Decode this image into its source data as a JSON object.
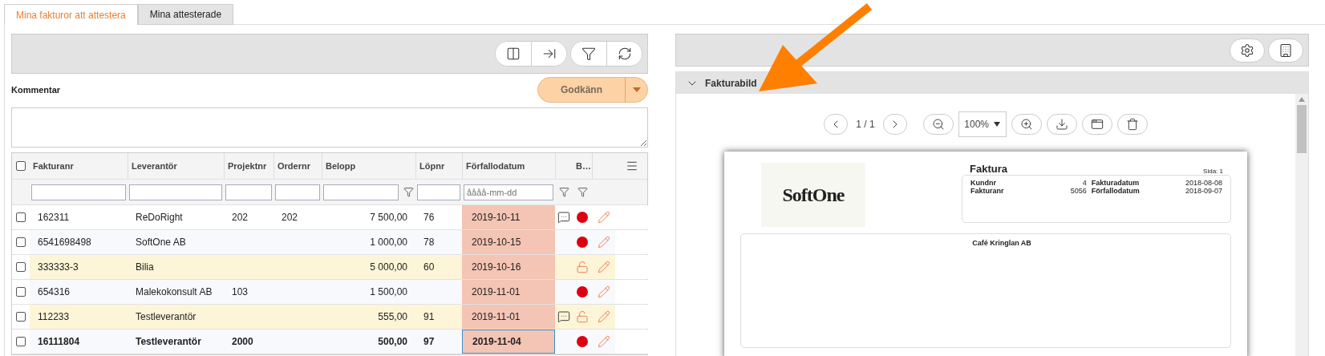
{
  "tabs": [
    {
      "label": "Mina fakturor att attestera",
      "selected": true
    },
    {
      "label": "Mina attesterade",
      "selected": false
    }
  ],
  "left_panel": {
    "comment_label": "Kommentar",
    "approve_button": "Godkänn",
    "table": {
      "select_all_checked": false,
      "columns": [
        "Fakturanr",
        "Leverantör",
        "Projektnr",
        "Ordernr",
        "Belopp",
        "Löpnr",
        "Förfallodatum",
        "B…"
      ],
      "date_filter_placeholder": "åååå-mm-dd",
      "rows": [
        {
          "checked": false,
          "fakturanr": "162311",
          "leverantor": "ReDoRight",
          "projektnr": "202",
          "ordernr": "202",
          "belopp": "7 500,00",
          "lopnr": "76",
          "forfallodatum": "2019-10-11",
          "comment": true,
          "locked": false,
          "highlighted": false,
          "selected": false
        },
        {
          "checked": false,
          "fakturanr": "6541698498",
          "leverantor": "SoftOne AB",
          "belopp": "1 000,00",
          "lopnr": "78",
          "forfallodatum": "2019-10-15",
          "comment": false,
          "locked": false,
          "highlighted": false,
          "selected": false
        },
        {
          "checked": false,
          "fakturanr": "333333-3",
          "leverantor": "Bilia",
          "belopp": "5 000,00",
          "lopnr": "60",
          "forfallodatum": "2019-10-16",
          "comment": false,
          "locked": true,
          "highlighted": true,
          "selected": false
        },
        {
          "checked": false,
          "fakturanr": "654316",
          "leverantor": "Malekokonsult AB",
          "projektnr": "103",
          "belopp": "1 500,00",
          "forfallodatum": "2019-11-01",
          "comment": false,
          "locked": false,
          "highlighted": false,
          "selected": false
        },
        {
          "checked": false,
          "fakturanr": "112233",
          "leverantor": "Testleverantör",
          "belopp": "555,00",
          "lopnr": "91",
          "forfallodatum": "2019-11-01",
          "comment": true,
          "locked": true,
          "highlighted": true,
          "selected": false
        },
        {
          "checked": false,
          "fakturanr": "16111804",
          "leverantor": "Testleverantör",
          "projektnr": "2000",
          "belopp": "500,00",
          "lopnr": "97",
          "forfallodatum": "2019-11-04",
          "comment": false,
          "locked": false,
          "highlighted": false,
          "selected": true
        }
      ]
    }
  },
  "invoice_viewer": {
    "title": "Fakturabild",
    "expanded": true,
    "page_indicator": "1 / 1",
    "zoom": "100%",
    "document": {
      "logo": "SoftOne",
      "title": "Faktura",
      "page_label": "Sida:",
      "page_number": "1",
      "fields": [
        {
          "label": "Kundnr",
          "value": "4"
        },
        {
          "label": "Fakturadatum",
          "value": "2018-08-08"
        },
        {
          "label": "Fakturanr",
          "value": "5056"
        },
        {
          "label": "Förfallodatum",
          "value": "2018-09-07"
        }
      ],
      "recipient": "Café Kringlan AB"
    }
  }
}
